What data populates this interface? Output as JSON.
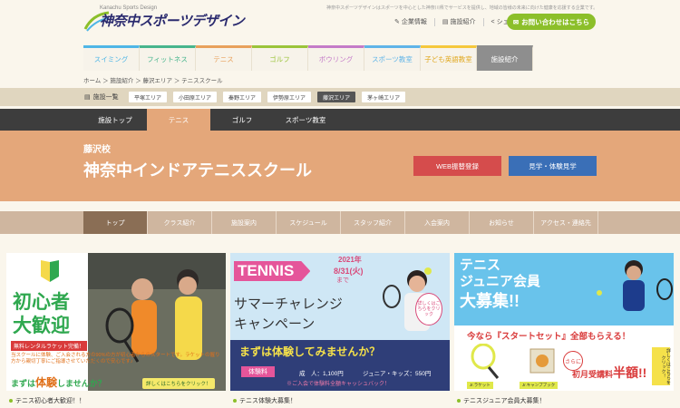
{
  "header": {
    "logo_sub": "Kanachu Sports Design",
    "logo": "神奈中スポーツデザイン",
    "tagline": "神奈中スポーツデザインはスポーツを中心とした神奈川県でサービスを提供し、地域の皆様の未来に向けた健康を応援する企業です。",
    "links": [
      "企業情報",
      "施設紹介",
      "シェア"
    ],
    "contact": "お問い合わせはこちら"
  },
  "topnav": [
    {
      "label": "スイミング",
      "color": "#4fb6e6"
    },
    {
      "label": "フィットネス",
      "color": "#47b58d"
    },
    {
      "label": "テニス",
      "color": "#e8a15c"
    },
    {
      "label": "ゴルフ",
      "color": "#9bc43a"
    },
    {
      "label": "ボウリング",
      "color": "#c47bc8"
    },
    {
      "label": "スポーツ教室",
      "color": "#5fb4e8"
    },
    {
      "label": "子ども英語教室",
      "color": "#f5c83c"
    },
    {
      "label": "施設紹介",
      "color": "#8e8e8e"
    }
  ],
  "breadcrumb": "ホーム ＞ 施設紹介 ＞ 藤沢エリア ＞ テニススクール",
  "area": {
    "title": "施設一覧",
    "items": [
      "平塚エリア",
      "小田原エリア",
      "秦野エリア",
      "伊勢原エリア",
      "藤沢エリア",
      "茅ヶ崎エリア"
    ]
  },
  "subnav": [
    "施設トップ",
    "テニス",
    "ゴルフ",
    "スポーツ教室"
  ],
  "hero": {
    "pre": "藤沢校",
    "title": "神奈中インドアテニススクール",
    "btn1": "WEB振替登録",
    "btn2": "見学・体験見学"
  },
  "pagenav": [
    "トップ",
    "クラス紹介",
    "施設案内",
    "スケジュール",
    "スタッフ紹介",
    "入会案内",
    "お知らせ",
    "アクセス・連絡先"
  ],
  "card1": {
    "title1": "初心者",
    "title2": "大歓迎",
    "badge": "無料レンタルラケット完備！",
    "body": "当スクールに体験、ご入会される方の90%の方が初心者からのスタートです。ラケットの握り方から親切丁寧にご指導させていただくので安心です♪",
    "cta_pre": "まずは",
    "cta_big": "体験",
    "cta_post": "しませんか？",
    "more": "詳しくはこちらをクリック！",
    "caption": "テニス初心者大歓迎！！"
  },
  "card2": {
    "date1": "2021年",
    "date2": "8/31(火)",
    "date3": "まで",
    "tennis": "TENNIS",
    "line1": "サマーチャレンジ",
    "line2": "キャンペーン",
    "more": "詳しくはこちらをクリック",
    "banner": "まずは体験してみませんか？",
    "fee_label": "体験料",
    "fee_adult": "成　人：1,100円",
    "fee_junior": "ジュニア・キッズ：550円",
    "note": "※ご入会で体験料全額キャッシュバック！",
    "caption": "テニス体験大募集！"
  },
  "card3": {
    "title1": "テニス",
    "title2": "ジュニア会員",
    "title3": "大募集!!",
    "promo": "今なら『スタートセット』全部もらえる！",
    "item1": "Jr.ラケット",
    "item2": "Jr.キャンプブック",
    "extra": "さらに",
    "fee": "初月受講料",
    "half": "半額!!",
    "more": "詳しくはこちらをクリック！",
    "caption": "テニスジュニア会員大募集！"
  }
}
